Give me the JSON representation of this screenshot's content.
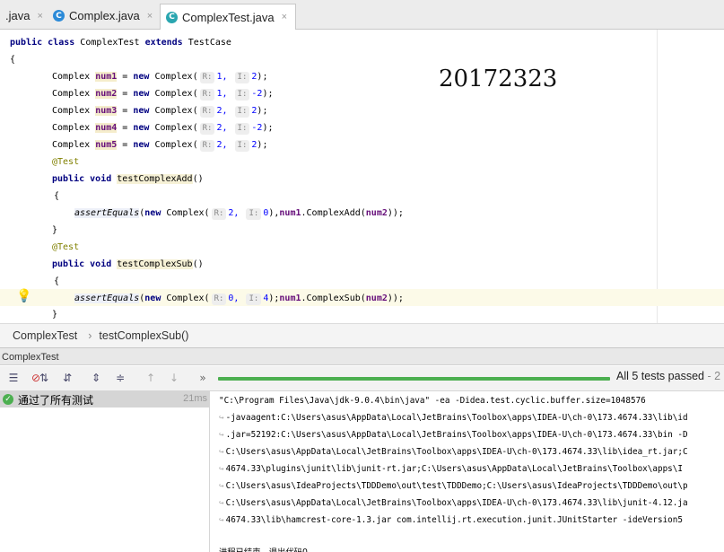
{
  "tabs": [
    {
      "label": ".java",
      "icon": "close-icon"
    },
    {
      "label": "Complex.java",
      "icon": "java-class-icon"
    },
    {
      "label": "ComplexTest.java",
      "icon": "java-test-class-icon"
    }
  ],
  "tab_close": "×",
  "code": {
    "l1": {
      "kw1": "public",
      "kw2": "class",
      "name": "ComplexTest",
      "kw3": "extends",
      "sup": "TestCase"
    },
    "brace_open": "{",
    "brace_close": "}",
    "fields": [
      {
        "type": "Complex",
        "name": "num1",
        "kw": "new",
        "ctor": "Complex",
        "rlabel": "R:",
        "r": "1,",
        "ilabel": "I:",
        "i": "2"
      },
      {
        "type": "Complex",
        "name": "num2",
        "kw": "new",
        "ctor": "Complex",
        "rlabel": "R:",
        "r": "1,",
        "ilabel": "I:",
        "i": "-2"
      },
      {
        "type": "Complex",
        "name": "num3",
        "kw": "new",
        "ctor": "Complex",
        "rlabel": "R:",
        "r": "2,",
        "ilabel": "I:",
        "i": "2"
      },
      {
        "type": "Complex",
        "name": "num4",
        "kw": "new",
        "ctor": "Complex",
        "rlabel": "R:",
        "r": "2,",
        "ilabel": "I:",
        "i": "-2"
      },
      {
        "type": "Complex",
        "name": "num5",
        "kw": "new",
        "ctor": "Complex",
        "rlabel": "R:",
        "r": "2,",
        "ilabel": "I:",
        "i": "2"
      }
    ],
    "annotation": "@Test",
    "kw_public": "public",
    "kw_void": "void",
    "m1": {
      "name": "testComplexAdd",
      "call": "assertEquals",
      "kw": "new",
      "ctor": "Complex",
      "rlabel": "R:",
      "r": "2,",
      "ilabel": "I:",
      "i": "0",
      "obj": "num1",
      "op": "ComplexAdd",
      "arg": "num2"
    },
    "m2": {
      "name": "testComplexSub",
      "call": "assertEquals",
      "kw": "new",
      "ctor": "Complex",
      "rlabel": "R:",
      "r": "0,",
      "ilabel": "I:",
      "i": "4",
      "obj": "num1",
      "op": "ComplexSub",
      "arg": "num2"
    }
  },
  "watermark": "20172323",
  "breadcrumb": {
    "class": "ComplexTest",
    "sep": "›",
    "method": "testComplexSub()"
  },
  "run": {
    "title": "ComplexTest",
    "status": "All 5 tests passed",
    "status_tail": " - 2",
    "tree_label": "通过了所有测试",
    "tree_time": "21ms",
    "progress": 1.0,
    "console": [
      "\"C:\\Program Files\\Java\\jdk-9.0.4\\bin\\java\" -ea -Didea.test.cyclic.buffer.size=1048576",
      "-javaagent:C:\\Users\\asus\\AppData\\Local\\JetBrains\\Toolbox\\apps\\IDEA-U\\ch-0\\173.4674.33\\lib\\id",
      ".jar=52192:C:\\Users\\asus\\AppData\\Local\\JetBrains\\Toolbox\\apps\\IDEA-U\\ch-0\\173.4674.33\\bin -D",
      "C:\\Users\\asus\\AppData\\Local\\JetBrains\\Toolbox\\apps\\IDEA-U\\ch-0\\173.4674.33\\lib\\idea_rt.jar;C",
      "4674.33\\plugins\\junit\\lib\\junit-rt.jar;C:\\Users\\asus\\AppData\\Local\\JetBrains\\Toolbox\\apps\\I",
      "C:\\Users\\asus\\IdeaProjects\\TDDDemo\\out\\test\\TDDDemo;C:\\Users\\asus\\IdeaProjects\\TDDDemo\\out\\p",
      "C:\\Users\\asus\\AppData\\Local\\JetBrains\\Toolbox\\apps\\IDEA-U\\ch-0\\173.4674.33\\lib\\junit-4.12.ja",
      "4674.33\\lib\\hamcrest-core-1.3.jar com.intellij.rt.execution.junit.JUnitStarter -ideVersion5"
    ],
    "console_tail": "进程已结束，退出代码0"
  },
  "colors": {
    "keyword": "#000080",
    "field": "#660e7a",
    "annotation": "#808000",
    "pass": "#4caf50"
  }
}
